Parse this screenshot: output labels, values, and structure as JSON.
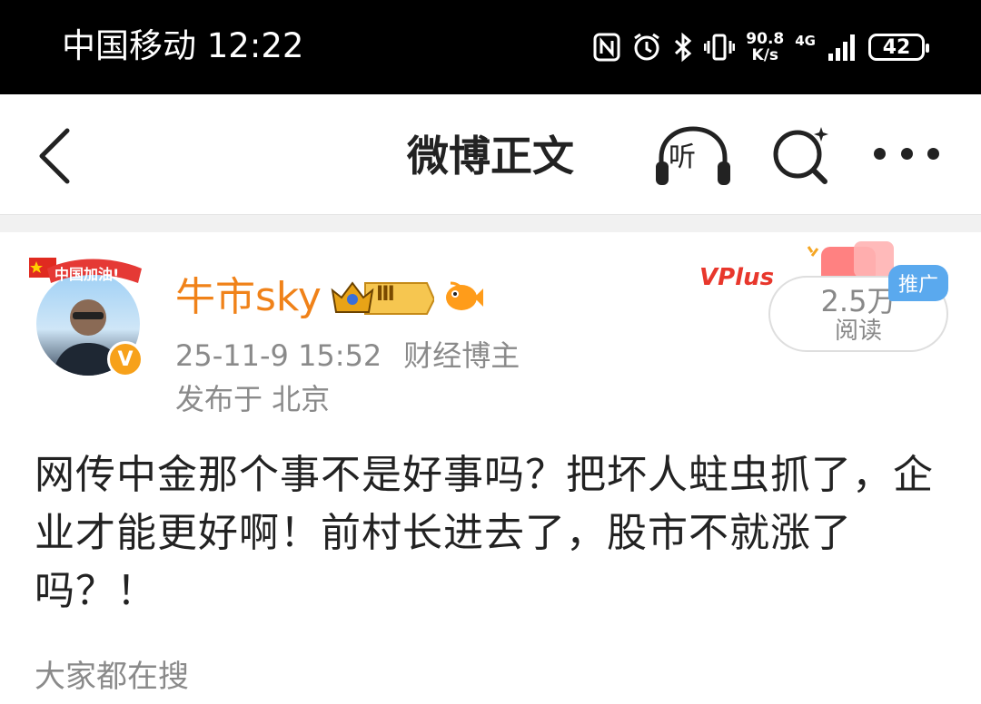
{
  "status_bar": {
    "carrier": "中国移动",
    "time": "12:22",
    "speed_value": "90.8",
    "speed_unit": "K/s",
    "network": "4G",
    "battery": "42"
  },
  "nav": {
    "title": "微博正文",
    "listen_label": "听"
  },
  "post": {
    "username": "牛市sky",
    "level": "Ⅲ",
    "avatar_banner": "中国加油!",
    "verified_mark": "V",
    "timestamp": "25-11-9 15:52",
    "author_tag": "财经博主",
    "location": "发布于 北京",
    "promo": "VPlus",
    "read_count": "2.5万",
    "read_label": "阅读",
    "ad_label": "推广",
    "content": "网传中金那个事不是好事吗？把坏人蛀虫抓了，企业才能更好啊！前村长进去了，股市不就涨了吗？！"
  },
  "footer": {
    "search_hint": "大家都在搜"
  },
  "colors": {
    "username": "#f08219",
    "meta_gray": "#8a8a8a",
    "status_bar_bg": "#000000",
    "ad_tag": "#5aa9ee",
    "verified_badge": "#f7a11a"
  }
}
